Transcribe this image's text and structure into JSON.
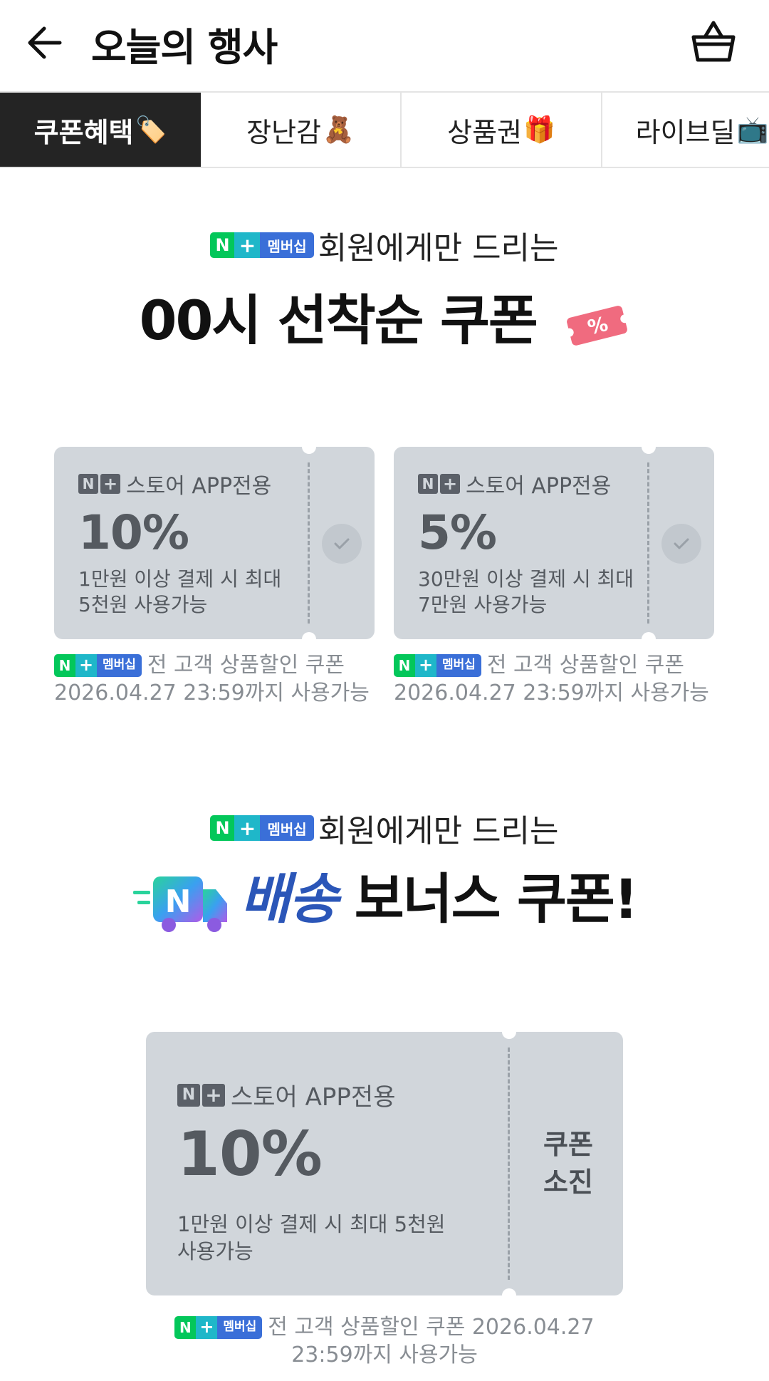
{
  "header": {
    "title": "오늘의 행사",
    "back_icon": "arrow-left-icon",
    "cart_icon": "shopping-bag-icon"
  },
  "tabs": [
    {
      "label": "쿠폰혜택",
      "emoji": "🏷️",
      "active": true
    },
    {
      "label": "장난감",
      "emoji": "🧸",
      "active": false
    },
    {
      "label": "상품권",
      "emoji": "🎁",
      "active": false
    },
    {
      "label": "라이브딜",
      "emoji": "📺",
      "active": false
    }
  ],
  "badge": {
    "n": "N",
    "plus": "+",
    "text": "멤버십"
  },
  "section1": {
    "subtitle": "회원에게만 드리는",
    "title": "00시 선착순 쿠폰",
    "ticket_symbol": "%"
  },
  "coupons_top": [
    {
      "store": "스토어 APP전용",
      "percent": "10%",
      "condition_line1": "1만원 이상 결제 시 최대",
      "condition_line2": "5천원 사용가능",
      "footer_label": "전 고객 상품할인 쿠폰",
      "footer_date": "2026.04.27 23:59까지 사용가능"
    },
    {
      "store": "스토어 APP전용",
      "percent": "5%",
      "condition_line1": "30만원 이상 결제 시 최대",
      "condition_line2": "7만원 사용가능",
      "footer_label": "전 고객 상품할인 쿠폰",
      "footer_date": "2026.04.27 23:59까지 사용가능"
    }
  ],
  "section2": {
    "subtitle": "회원에게만 드리는",
    "title_blue": "배송",
    "title_rest": "보너스 쿠폰!",
    "truck_letter": "N"
  },
  "coupon_bottom": {
    "store": "스토어 APP전용",
    "percent": "10%",
    "condition_line1": "1만원 이상 결제 시 최대 5천원",
    "condition_line2": "사용가능",
    "status_line1": "쿠폰",
    "status_line2": "소진",
    "footer_line1": "전 고객 상품할인 쿠폰 2026.04.27",
    "footer_line2": "23:59까지 사용가능"
  },
  "colors": {
    "accent_green": "#03c75a",
    "membership_blue": "#3a6fd8",
    "coupon_bg": "#d1d6db",
    "active_tab_bg": "#242424",
    "title_blue": "#2b56b8"
  }
}
